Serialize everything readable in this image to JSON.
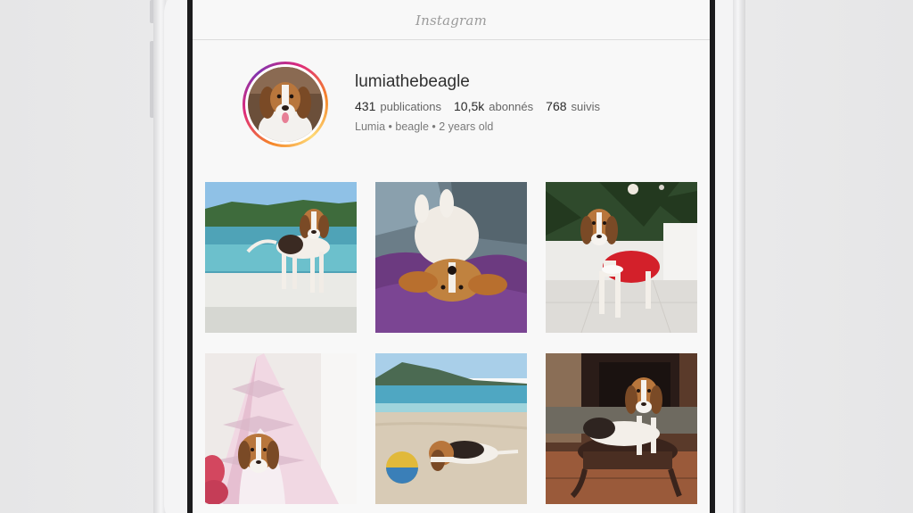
{
  "app": {
    "title": "Instagram"
  },
  "profile": {
    "username": "lumiathebeagle",
    "stats": {
      "posts_count": "431",
      "posts_label": "publications",
      "followers_count": "10,5k",
      "followers_label": "abonnés",
      "following_count": "768",
      "following_label": "suivis"
    },
    "bio": "Lumia • beagle • 2 years old",
    "avatar_story_ring_colors": [
      "#f58529",
      "#dd2a7b",
      "#8134af",
      "#feda77"
    ]
  },
  "grid": {
    "posts": [
      {
        "subject": "beagle standing on dock by the sea"
      },
      {
        "subject": "beagle lying upside down on purple blanket"
      },
      {
        "subject": "beagle in red Santa coat by Christmas tree"
      },
      {
        "subject": "beagle in pink teepee tent"
      },
      {
        "subject": "beagle lying on sandy beach with ball"
      },
      {
        "subject": "beagle on leather footstool by fireplace"
      }
    ]
  }
}
